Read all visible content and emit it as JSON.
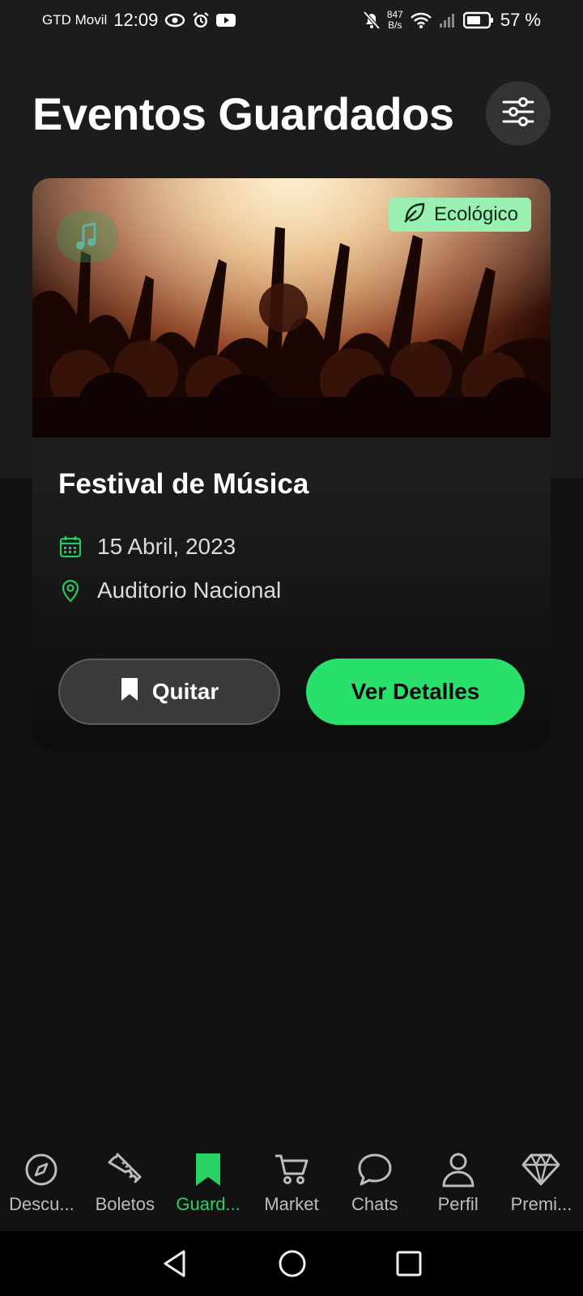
{
  "status_bar": {
    "carrier": "GTD Movil",
    "time": "12:09",
    "net_speed_value": "847",
    "net_speed_unit": "B/s",
    "battery": "57 %"
  },
  "header": {
    "title": "Eventos Guardados",
    "filter_icon": "sliders-icon"
  },
  "event_card": {
    "badge_label": "Ecológico",
    "title": "Festival de Música",
    "date": "15 Abril, 2023",
    "location": "Auditorio Nacional",
    "remove_label": "Quitar",
    "details_label": "Ver Detalles",
    "accent_color": "#28e06a"
  },
  "bottom_nav": {
    "items": [
      {
        "label": "Descu...",
        "icon": "compass-icon",
        "active": false
      },
      {
        "label": "Boletos",
        "icon": "ticket-icon",
        "active": false
      },
      {
        "label": "Guard...",
        "icon": "bookmark-icon",
        "active": true
      },
      {
        "label": "Market",
        "icon": "cart-icon",
        "active": false
      },
      {
        "label": "Chats",
        "icon": "chat-icon",
        "active": false
      },
      {
        "label": "Perfil",
        "icon": "user-icon",
        "active": false
      },
      {
        "label": "Premi...",
        "icon": "diamond-icon",
        "active": false
      }
    ]
  }
}
